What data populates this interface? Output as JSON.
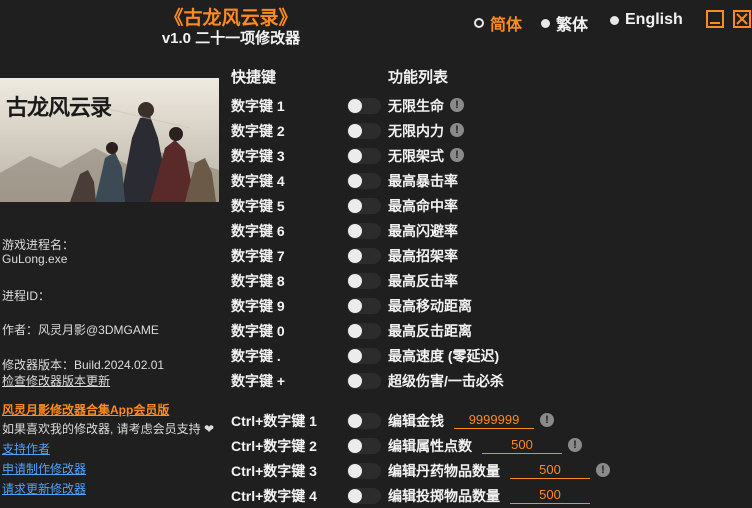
{
  "header": {
    "title": "《古龙风云录》",
    "subtitle": "v1.0 二十一项修改器",
    "languages": [
      {
        "label": "简体",
        "active": true
      },
      {
        "label": "繁体",
        "active": false
      },
      {
        "label": "English",
        "active": false
      }
    ]
  },
  "left": {
    "process_label": "游戏进程名：",
    "process_name": "GuLong.exe",
    "process_id_label": "进程ID：",
    "author": "作者：风灵月影@3DMGAME",
    "version": "修改器版本：Build.2024.02.01",
    "check_update": "检查修改器版本更新",
    "app_link": "风灵月影修改器合集App会员版",
    "support_text": "如果喜欢我的修改器, 请考虑会员支持",
    "support_author": "支持作者",
    "request_make": "申请制作修改器",
    "request_update": "请求更新修改器"
  },
  "table": {
    "col_hotkey": "快捷键",
    "col_function": "功能列表",
    "rows": [
      {
        "key": "数字键 1",
        "func": "无限生命",
        "warn": true
      },
      {
        "key": "数字键 2",
        "func": "无限内力",
        "warn": true
      },
      {
        "key": "数字键 3",
        "func": "无限架式",
        "warn": true
      },
      {
        "key": "数字键 4",
        "func": "最高暴击率"
      },
      {
        "key": "数字键 5",
        "func": "最高命中率"
      },
      {
        "key": "数字键 6",
        "func": "最高闪避率"
      },
      {
        "key": "数字键 7",
        "func": "最高招架率"
      },
      {
        "key": "数字键 8",
        "func": "最高反击率"
      },
      {
        "key": "数字键 9",
        "func": "最高移动距离"
      },
      {
        "key": "数字键 0",
        "func": "最高反击距离"
      },
      {
        "key": "数字键 .",
        "func": "最高速度 (零延迟)"
      },
      {
        "key": "数字键 +",
        "func": "超级伤害/一击必杀"
      }
    ],
    "ctrl_rows": [
      {
        "key": "Ctrl+数字键 1",
        "func": "编辑金钱",
        "value": "9999999",
        "warn": true
      },
      {
        "key": "Ctrl+数字键 2",
        "func": "编辑属性点数",
        "value": "500",
        "warn": true
      },
      {
        "key": "Ctrl+数字键 3",
        "func": "编辑丹药物品数量",
        "value": "500",
        "warn": true
      },
      {
        "key": "Ctrl+数字键 4",
        "func": "编辑投掷物品数量",
        "value": "500",
        "warn": false
      }
    ]
  },
  "colors": {
    "accent": "#ff8a1d",
    "background": "#1f1f1f",
    "link": "#4ea2ff"
  },
  "icons": [
    "minimize-icon",
    "close-icon",
    "warning-icon",
    "heart-icon"
  ]
}
